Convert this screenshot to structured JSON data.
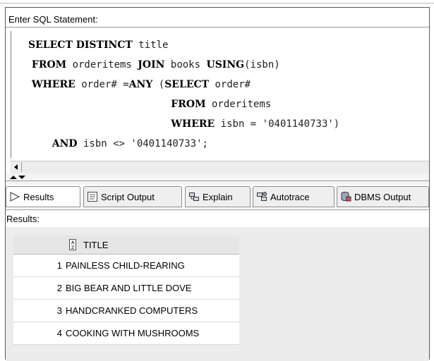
{
  "editor": {
    "label": "Enter SQL Statement:",
    "lines": [
      [
        {
          "t": "kw",
          "v": "SELECT DISTINCT"
        },
        {
          "t": "txt",
          "v": " title"
        }
      ],
      [
        {
          "t": "kw",
          "v": " FROM"
        },
        {
          "t": "txt",
          "v": " orderitems "
        },
        {
          "t": "kw",
          "v": "JOIN"
        },
        {
          "t": "txt",
          "v": " books "
        },
        {
          "t": "kw",
          "v": "USING"
        },
        {
          "t": "txt",
          "v": "(isbn)"
        }
      ],
      [
        {
          "t": "kw",
          "v": " WHERE"
        },
        {
          "t": "txt",
          "v": " order# ="
        },
        {
          "t": "kw",
          "v": "ANY"
        },
        {
          "t": "txt",
          "v": " ("
        },
        {
          "t": "kw",
          "v": "SELECT"
        },
        {
          "t": "txt",
          "v": " order#"
        }
      ],
      [
        {
          "t": "txt",
          "v": "                        "
        },
        {
          "t": "kw",
          "v": "FROM"
        },
        {
          "t": "txt",
          "v": " orderitems"
        }
      ],
      [
        {
          "t": "txt",
          "v": "                        "
        },
        {
          "t": "kw",
          "v": "WHERE"
        },
        {
          "t": "txt",
          "v": " isbn = '0401140733')"
        }
      ],
      [
        {
          "t": "txt",
          "v": "    "
        },
        {
          "t": "kw",
          "v": "AND"
        },
        {
          "t": "txt",
          "v": " isbn <> '0401140733';"
        }
      ]
    ]
  },
  "tabs": [
    {
      "label": "Results",
      "icon": "play-icon",
      "active": true
    },
    {
      "label": "Script Output",
      "icon": "script-icon",
      "active": false
    },
    {
      "label": "Explain",
      "icon": "explain-icon",
      "active": false
    },
    {
      "label": "Autotrace",
      "icon": "autotrace-icon",
      "active": false
    },
    {
      "label": "DBMS Output",
      "icon": "dbms-icon",
      "active": false
    }
  ],
  "results": {
    "label": "Results:",
    "column": "TITLE",
    "rows": [
      {
        "n": "1",
        "title": "PAINLESS CHILD-REARING"
      },
      {
        "n": "2",
        "title": "BIG BEAR AND LITTLE DOVE"
      },
      {
        "n": "3",
        "title": "HANDCRANKED COMPUTERS"
      },
      {
        "n": "4",
        "title": "COOKING WITH MUSHROOMS"
      }
    ]
  }
}
